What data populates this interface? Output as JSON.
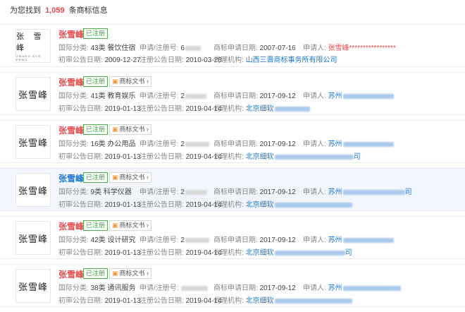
{
  "header": {
    "prefix": "为您找到",
    "count": "1,059",
    "suffix": "条商标信息"
  },
  "labels": {
    "intl_class": "国际分类:",
    "reg_no": "申请/注册号:",
    "apply_date": "商标申请日期:",
    "applicant": "申请人:",
    "prelim_date": "初审公告日期:",
    "reg_date": "注册公告日期:",
    "agent": "代理机构:",
    "doc_button": "商标文书"
  },
  "rows": [
    {
      "name": "张雪峰",
      "logo_text": "张 雪 峰",
      "logo_sub": "ZHANG XUE FENG",
      "status": "已注册",
      "intl_class": "43类 餐饮住宿",
      "reg_no": "6",
      "apply_date": "2007-07-16",
      "applicant": "张雪峰*****************",
      "prelim_date": "2009-12-27",
      "reg_date": "2010-03-28",
      "agent": "山西三晋商标事务所有限公司"
    },
    {
      "name": "张雪峰",
      "logo_text": "张雪峰",
      "status": "已注册",
      "intl_class": "41类 教育娱乐",
      "reg_no": "2",
      "apply_date": "2017-09-12",
      "applicant": "苏州",
      "prelim_date": "2019-01-13",
      "reg_date": "2019-04-14",
      "agent": "北京细软"
    },
    {
      "name": "张雪峰",
      "logo_text": "张雪峰",
      "status": "已注册",
      "intl_class": "16类 办公用品",
      "reg_no": "2",
      "apply_date": "2017-09-12",
      "applicant": "苏州",
      "prelim_date": "2019-01-13",
      "reg_date": "2019-04-14",
      "agent": "北京细软",
      "agent_tail": "司"
    },
    {
      "name": "张雪峰",
      "logo_text": "张雪峰",
      "status": "已注册",
      "intl_class": "9类 科学仪器",
      "reg_no": "2",
      "apply_date": "2017-09-12",
      "applicant": "苏州",
      "applicant_tail": "司",
      "prelim_date": "2019-01-13",
      "reg_date": "2019-04-14",
      "agent": "北京细软"
    },
    {
      "name": "张雪峰",
      "logo_text": "张雪峰",
      "status": "已注册",
      "intl_class": "42类 设计研究",
      "reg_no": "2",
      "apply_date": "2017-09-12",
      "applicant": "苏州",
      "prelim_date": "2019-01-13",
      "reg_date": "2019-04-14",
      "agent": "北京细软",
      "agent_tail": "司"
    },
    {
      "name": "张雪峰",
      "logo_text": "张雪峰",
      "status": "已注册",
      "intl_class": "38类 通讯服务",
      "reg_no": "",
      "apply_date": "2017-09-12",
      "applicant": "苏州",
      "prelim_date": "2019-01-13",
      "reg_date": "2019-04-14",
      "agent": "北京细软"
    }
  ],
  "colors": {
    "accent_red": "#e54b4b",
    "link_blue": "#1a76d2",
    "status_green": "#3aa33a",
    "highlight_bg": "#f2f6fc"
  }
}
